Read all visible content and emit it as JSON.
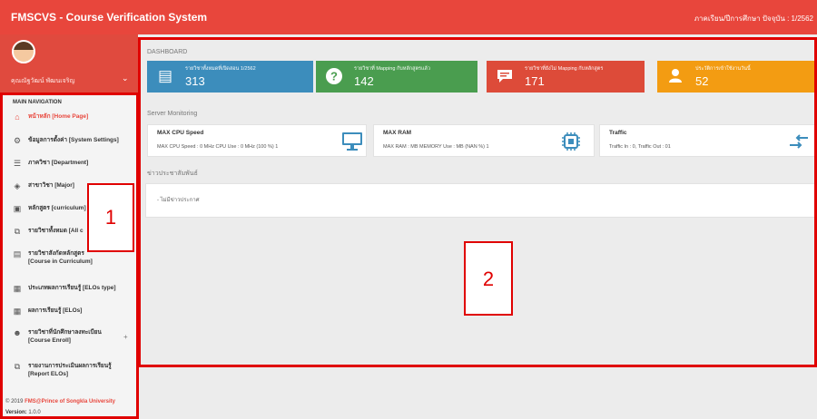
{
  "header": {
    "title": "FMSCVS - Course Verification System",
    "semester": "ภาคเรียน/ปีการศึกษา ปัจจุบัน : 1/2562"
  },
  "sidebar": {
    "user_name": "คุณณัฐวัฒน์ พัฒนเจริญ",
    "nav_header": "MAIN NAVIGATION",
    "items": [
      {
        "label": "หน้าหลัก [Home Page]",
        "icon": "home-icon",
        "active": true
      },
      {
        "label": "ข้อมูลการตั้งค่า [System Settings]",
        "icon": "gear-icon"
      },
      {
        "label": "ภาควิชา [Department]",
        "icon": "list-icon"
      },
      {
        "label": "สาขาวิชา [Major]",
        "icon": "layers-icon"
      },
      {
        "label": "หลักสูตร [curriculum]",
        "icon": "book-icon"
      },
      {
        "label": "รายวิชาทั้งหมด [All c",
        "icon": "copy-icon"
      },
      {
        "label": "รายวิชาสังกัดหลักสูตร",
        "label2": "[Course in Curriculum]",
        "icon": "document-icon"
      },
      {
        "label": "ประเภทผลการเรียนรู้ [ELOs type]",
        "icon": "grid-icon"
      },
      {
        "label": "ผลการเรียนรู้ [ELOs]",
        "icon": "grid-icon"
      },
      {
        "label": "รายวิชาที่นักศึกษาลงทะเบียน",
        "label2": "[Course Enroll]",
        "icon": "user-add-icon",
        "expandable": true,
        "plus": "+"
      },
      {
        "label": "รายงานการประเมินผลการเรียนรู้",
        "label2": "[Report ELOs]",
        "icon": "copy-icon"
      }
    ],
    "footer": {
      "copyright": "© 2019",
      "org": "FMS@Prince of Songkla University",
      "version_label": "Version:",
      "version": "1.0.0"
    }
  },
  "main": {
    "dashboard_title": "DASHBOARD",
    "stats": [
      {
        "label": "รายวิชาทั้งหมดที่เปิดสอน 1/2562",
        "value": "313",
        "color": "#3c8dbc",
        "icon": "list-alt-icon"
      },
      {
        "label": "รายวิชาที่ Mapping กับหลักสูตรแล้ว",
        "value": "142",
        "color": "#4a9d4f",
        "icon": "question-circle-icon"
      },
      {
        "label": "รายวิชาที่ยังไม่ Mapping กับหลักสูตร",
        "value": "171",
        "color": "#dd4b39",
        "icon": "chat-icon"
      },
      {
        "label": "ประวัติการเข้าใช้งานวันนี้",
        "value": "52",
        "color": "#f39c12",
        "icon": "user-icon"
      }
    ],
    "server_title": "Server Monitoring",
    "monitors": [
      {
        "title": "MAX CPU Speed",
        "detail": "MAX CPU Speed : 0 MHz CPU Use : 0 MHz (100 %) 1",
        "icon": "monitor-icon"
      },
      {
        "title": "MAX RAM",
        "detail": "MAX RAM : MB MEMORY Use : MB (NAN %) 1",
        "icon": "chip-icon"
      },
      {
        "title": "Traffic",
        "detail": "Traffic In : 0, Traffic Out : 01",
        "icon": "traffic-icon"
      }
    ],
    "news_title": "ข่าวประชาสัมพันธ์",
    "news_text": "- ไม่มีข่าวประกาศ"
  },
  "annotations": {
    "label_1": "1",
    "label_2": "2"
  },
  "colors": {
    "accent": "#e8463c",
    "outline": "#e00000"
  }
}
